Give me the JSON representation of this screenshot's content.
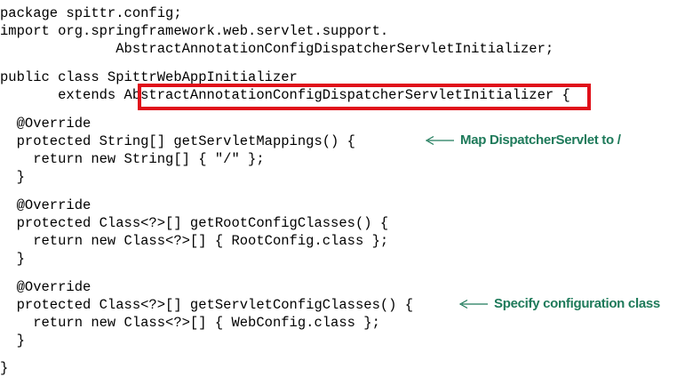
{
  "code": {
    "lines": [
      "package spittr.config;",
      "import org.springframework.web.servlet.support.",
      "              AbstractAnnotationConfigDispatcherServletInitializer;",
      "public class SpittrWebAppInitializer",
      "       extends AbstractAnnotationConfigDispatcherServletInitializer {",
      "  @Override",
      "  protected String[] getServletMappings() {",
      "    return new String[] { \"/\" };",
      "  }",
      "  @Override",
      "  protected Class<?>[] getRootConfigClasses() {",
      "    return new Class<?>[] { RootConfig.class };",
      "  }",
      "  @Override",
      "  protected Class<?>[] getServletConfigClasses() {",
      "    return new Class<?>[] { WebConfig.class };",
      "  }",
      "}"
    ]
  },
  "annotations": {
    "servlet_mapping": "Map DispatcherServlet to /",
    "config_class": "Specify configuration class"
  },
  "colors": {
    "annotation_text": "#1e7a5a",
    "highlight_border": "#e0101a"
  }
}
